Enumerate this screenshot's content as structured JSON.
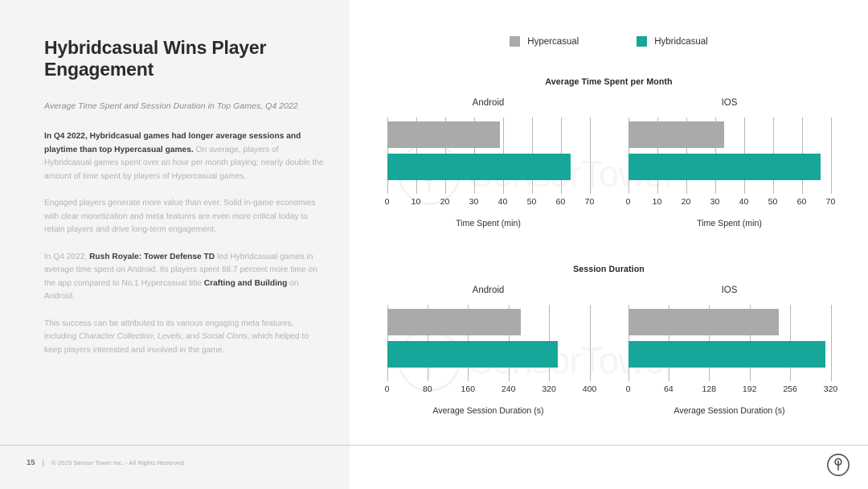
{
  "slide": {
    "title": "Hybridcasual Wins Player Engagement",
    "subtitle": "Average Time Spent and Session Duration in Top Games, Q4 2022",
    "paragraphs": [
      {
        "bold_lead": "In Q4 2022, Hybridcasual games had longer average sessions and playtime than top Hypercasual games.",
        "rest": " On average, players of Hybridcasual games spent over an hour per month playing; nearly double the amount of time spent by players of Hypercasual games."
      },
      {
        "bold_lead": "",
        "rest": "Engaged players generate more value than ever. Solid in-game economies with clear monetization and meta features are even more critical today to retain players and drive long-term engagement."
      }
    ],
    "paragraph3": {
      "p1": "In Q4 2022, ",
      "b1": "Rush Royale: Tower Defense TD",
      "p2": " led Hybridcasual games in average time spent on Android. Its players spent 88.7 percent more time on the app compared to No.1 Hypercasual title ",
      "b2": "Crafting and Building",
      "p3": " on Android."
    },
    "paragraph4": {
      "p1": "This success can be attributed to its various engaging meta features, including ",
      "i1": "Character Collection",
      "p2": ", ",
      "i2": "Levels",
      "p3": ", and ",
      "i3": "Social Clons",
      "p4": ", which helped to keep players interested and involved in the game."
    }
  },
  "footer": {
    "page_number": "15",
    "separator": "|",
    "copyright": "© 2023 Sensor Tower Inc. - All Rights Reserved",
    "logo_icon": "sensor-tower-logo-icon"
  },
  "watermark": {
    "text": "SensorTower",
    "logo_icon": "sensor-tower-watermark-icon"
  },
  "legend": {
    "items": [
      {
        "label": "Hypercasual",
        "color": "#aaaaaa"
      },
      {
        "label": "Hybridcasual",
        "color": "#17a79a"
      }
    ]
  },
  "chart_data": [
    {
      "type": "bar",
      "title": "Average Time Spent per Month",
      "orientation": "horizontal",
      "grid": true,
      "legend_position": "top-center",
      "panels": [
        {
          "name": "Android",
          "xlabel": "Time Spent (min)",
          "xlim": [
            0,
            70
          ],
          "ticks": [
            "0",
            "10",
            "20",
            "30",
            "40",
            "50",
            "60",
            "70"
          ],
          "tick_values": [
            0,
            10,
            20,
            30,
            40,
            50,
            60,
            70
          ],
          "categories": [
            "Hypercasual",
            "Hybridcasual"
          ],
          "values": [
            39.0,
            63.5
          ],
          "colors": [
            "#aaaaaa",
            "#17a79a"
          ]
        },
        {
          "name": "IOS",
          "xlabel": "Time Spent (min)",
          "xlim": [
            0,
            70
          ],
          "ticks": [
            "0",
            "10",
            "20",
            "30",
            "40",
            "50",
            "60",
            "70"
          ],
          "tick_values": [
            0,
            10,
            20,
            30,
            40,
            50,
            60,
            70
          ],
          "categories": [
            "Hypercasual",
            "Hybridcasual"
          ],
          "values": [
            33.3,
            66.4
          ],
          "colors": [
            "#aaaaaa",
            "#17a79a"
          ]
        }
      ]
    },
    {
      "type": "bar",
      "title": "Session Duration",
      "orientation": "horizontal",
      "grid": true,
      "legend_position": "top-center",
      "panels": [
        {
          "name": "Android",
          "xlabel": "Average Session Duration (s)",
          "xlim": [
            0,
            400
          ],
          "ticks": [
            "0",
            "80",
            "160",
            "240",
            "320",
            "400"
          ],
          "tick_values": [
            0,
            80,
            160,
            240,
            320,
            400
          ],
          "categories": [
            "Hypercasual",
            "Hybridcasual"
          ],
          "values": [
            265,
            337
          ],
          "colors": [
            "#aaaaaa",
            "#17a79a"
          ]
        },
        {
          "name": "IOS",
          "xlabel": "Average Session Duration (s)",
          "xlim": [
            0,
            320
          ],
          "ticks": [
            "0",
            "64",
            "128",
            "192",
            "256",
            "320"
          ],
          "tick_values": [
            0,
            64,
            128,
            192,
            256,
            320
          ],
          "categories": [
            "Hypercasual",
            "Hybridcasual"
          ],
          "values": [
            238,
            312
          ],
          "colors": [
            "#aaaaaa",
            "#17a79a"
          ]
        }
      ]
    }
  ]
}
